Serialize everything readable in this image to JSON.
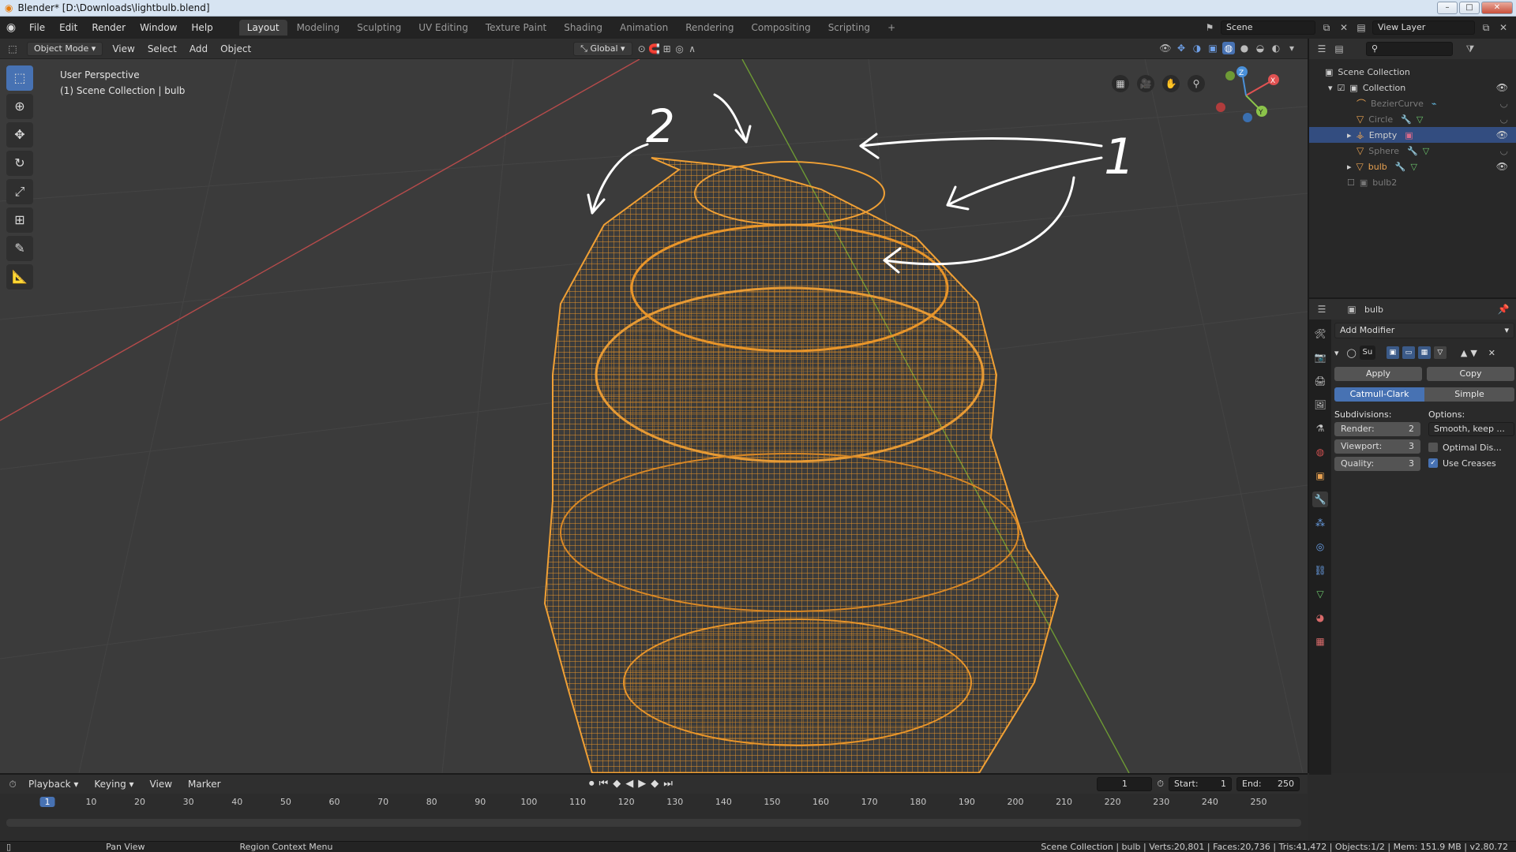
{
  "window": {
    "title": "Blender* [D:\\Downloads\\lightbulb.blend]",
    "controls": {
      "min": "–",
      "max": "□",
      "close": "✕"
    }
  },
  "topbar": {
    "menus": [
      "File",
      "Edit",
      "Render",
      "Window",
      "Help"
    ],
    "workspaces": [
      "Layout",
      "Modeling",
      "Sculpting",
      "UV Editing",
      "Texture Paint",
      "Shading",
      "Animation",
      "Rendering",
      "Compositing",
      "Scripting"
    ],
    "active_workspace": "Layout",
    "add_tab": "+",
    "scene": "Scene",
    "view_layer": "View Layer"
  },
  "viewport_header": {
    "mode": "Object Mode",
    "menus": [
      "View",
      "Select",
      "Add",
      "Object"
    ],
    "transform_orientation": "Global"
  },
  "viewport": {
    "info_line1": "User Perspective",
    "info_line2": "(1) Scene Collection | bulb",
    "annotation_1": "1",
    "annotation_2": "2",
    "gizmo_axes": {
      "x": "X",
      "y": "Y",
      "z": "Z"
    }
  },
  "outliner": {
    "root": "Scene Collection",
    "items": [
      {
        "label": "Collection"
      },
      {
        "label": "BezierCurve"
      },
      {
        "label": "Circle"
      },
      {
        "label": "Empty"
      },
      {
        "label": "Sphere"
      },
      {
        "label": "bulb"
      },
      {
        "label": "bulb2"
      }
    ]
  },
  "properties": {
    "object_name": "bulb",
    "add_modifier": "Add Modifier",
    "modifier_short": "Su",
    "apply": "Apply",
    "copy": "Copy",
    "algo_catmull": "Catmull-Clark",
    "algo_simple": "Simple",
    "subdivisions_label": "Subdivisions:",
    "options_label": "Options:",
    "render_label": "Render:",
    "render_value": "2",
    "viewport_label": "Viewport:",
    "viewport_value": "3",
    "quality_label": "Quality:",
    "quality_value": "3",
    "uv_smooth": "Smooth, keep ...",
    "optimal_display": "Optimal Dis...",
    "use_creases": "Use Creases"
  },
  "timeline": {
    "menus": [
      "Playback",
      "Keying",
      "View",
      "Marker"
    ],
    "current_frame": "1",
    "start_label": "Start:",
    "start_value": "1",
    "end_label": "End:",
    "end_value": "250",
    "ticks": [
      "1",
      "10",
      "20",
      "30",
      "40",
      "50",
      "60",
      "70",
      "80",
      "90",
      "100",
      "110",
      "120",
      "130",
      "140",
      "150",
      "160",
      "170",
      "180",
      "190",
      "200",
      "210",
      "220",
      "230",
      "240",
      "250"
    ]
  },
  "statusbar": {
    "pan_view": "Pan View",
    "region_context_menu": "Region Context Menu",
    "stats": "Scene Collection | bulb | Verts:20,801 | Faces:20,736 | Tris:41,472 | Objects:1/2 | Mem: 151.9 MB | v2.80.72"
  },
  "colors": {
    "wire": "#e8952a",
    "accent": "#4772b3",
    "selected_row": "#334d80"
  }
}
